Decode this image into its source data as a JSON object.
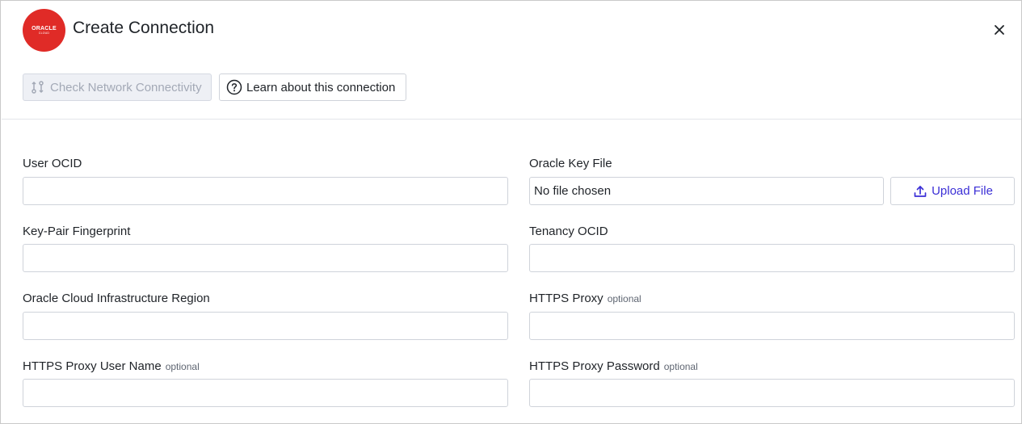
{
  "header": {
    "logo_word": "ORACLE",
    "logo_sub": "CLOUD",
    "title": "Create Connection",
    "close_icon": "close-icon"
  },
  "toolbar": {
    "check_network_label": "Check Network Connectivity",
    "check_network_icon": "network-check-icon",
    "learn_label": "Learn about this connection",
    "learn_icon": "help-circle-icon"
  },
  "form": {
    "optional_tag": "optional",
    "user_ocid": {
      "label": "User OCID",
      "value": ""
    },
    "key_file": {
      "label": "Oracle Key File",
      "value": "No file chosen",
      "upload_label": "Upload File",
      "upload_icon": "upload-icon"
    },
    "fingerprint": {
      "label": "Key-Pair Fingerprint",
      "value": ""
    },
    "tenancy_ocid": {
      "label": "Tenancy OCID",
      "value": ""
    },
    "region": {
      "label": "Oracle Cloud Infrastructure Region",
      "value": ""
    },
    "https_proxy": {
      "label": "HTTPS Proxy",
      "value": ""
    },
    "proxy_user": {
      "label": "HTTPS Proxy User Name",
      "value": ""
    },
    "proxy_password": {
      "label": "HTTPS Proxy Password",
      "value": ""
    }
  },
  "colors": {
    "brand_red": "#e02b27",
    "accent": "#3b2fd6",
    "disabled_bg": "#eef0f5",
    "border": "#cfd3da"
  }
}
